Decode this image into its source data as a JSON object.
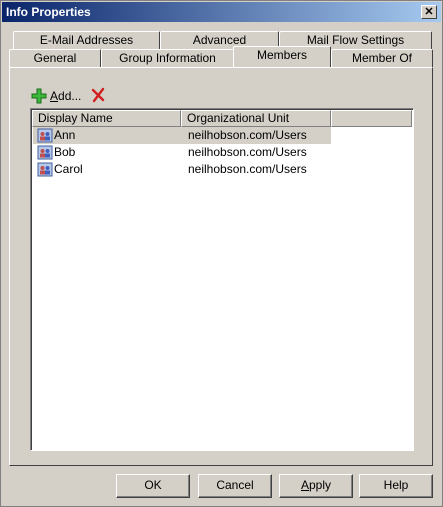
{
  "window": {
    "title": "Info Properties",
    "close_glyph": "✕"
  },
  "tabs_row1": [
    {
      "label": "E-Mail Addresses"
    },
    {
      "label": "Advanced"
    },
    {
      "label": "Mail Flow Settings"
    }
  ],
  "tabs_row2": [
    {
      "label": "General"
    },
    {
      "label": "Group Information"
    },
    {
      "label": "Members",
      "active": true
    },
    {
      "label": "Member Of"
    }
  ],
  "toolbar": {
    "add_label_prefix": "A",
    "add_label_rest": "dd...",
    "add_icon": "green-plus-icon",
    "remove_icon": "red-x-icon"
  },
  "list": {
    "columns": [
      "Display Name",
      "Organizational Unit"
    ],
    "rows": [
      {
        "name": "Ann",
        "ou": "neilhobson.com/Users",
        "selected": true
      },
      {
        "name": "Bob",
        "ou": "neilhobson.com/Users"
      },
      {
        "name": "Carol",
        "ou": "neilhobson.com/Users"
      }
    ]
  },
  "buttons": {
    "ok": "OK",
    "cancel": "Cancel",
    "apply_prefix": "A",
    "apply_rest": "pply",
    "help": "Help"
  }
}
